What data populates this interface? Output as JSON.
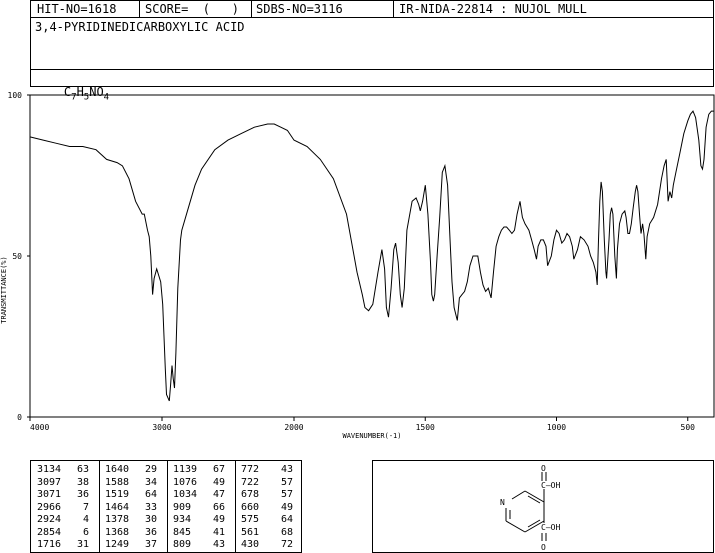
{
  "header": {
    "hit_no": "HIT-NO=1618",
    "score": "SCORE=  (   )",
    "sdbs_no": "SDBS-NO=3116",
    "ir_info": "IR-NIDA-22814 : NUJOL MULL"
  },
  "compound": {
    "name": "3,4-PYRIDINEDICARBOXYLIC ACID",
    "formula_parts": [
      "C",
      "7",
      "H",
      "5",
      "NO",
      "4"
    ]
  },
  "chart_data": {
    "type": "line",
    "xlabel": "WAVENUMBER(-1)",
    "ylabel": "TRANSMITTANCE(%)",
    "xlim": [
      4000,
      400
    ],
    "ylim": [
      0,
      100
    ],
    "x_ticks": [
      4000,
      3000,
      2000,
      1500,
      1000,
      500
    ],
    "y_ticks": [
      0,
      50,
      100
    ],
    "x_tick_labels": [
      "4000",
      "3000",
      "2000",
      "1500",
      "1000",
      "500"
    ],
    "y_tick_labels": [
      "0",
      "50",
      "100"
    ],
    "grid": false,
    "series": [
      {
        "points": [
          [
            4000,
            87
          ],
          [
            3900,
            86
          ],
          [
            3800,
            85
          ],
          [
            3700,
            84
          ],
          [
            3600,
            84
          ],
          [
            3500,
            83
          ],
          [
            3420,
            80
          ],
          [
            3340,
            79
          ],
          [
            3300,
            78
          ],
          [
            3250,
            74
          ],
          [
            3200,
            67
          ],
          [
            3150,
            63
          ],
          [
            3134,
            63
          ],
          [
            3110,
            58
          ],
          [
            3097,
            56
          ],
          [
            3085,
            50
          ],
          [
            3071,
            38
          ],
          [
            3060,
            43
          ],
          [
            3040,
            46
          ],
          [
            3010,
            42
          ],
          [
            2995,
            35
          ],
          [
            2985,
            25
          ],
          [
            2975,
            15
          ],
          [
            2966,
            7
          ],
          [
            2955,
            6
          ],
          [
            2945,
            5
          ],
          [
            2935,
            10
          ],
          [
            2924,
            16
          ],
          [
            2915,
            12
          ],
          [
            2905,
            9
          ],
          [
            2895,
            20
          ],
          [
            2880,
            40
          ],
          [
            2860,
            55
          ],
          [
            2850,
            58
          ],
          [
            2800,
            65
          ],
          [
            2750,
            72
          ],
          [
            2700,
            77
          ],
          [
            2600,
            83
          ],
          [
            2500,
            86
          ],
          [
            2400,
            88
          ],
          [
            2300,
            90
          ],
          [
            2200,
            91
          ],
          [
            2150,
            91
          ],
          [
            2100,
            90
          ],
          [
            2050,
            89
          ],
          [
            2000,
            86
          ],
          [
            1950,
            84
          ],
          [
            1900,
            80
          ],
          [
            1850,
            74
          ],
          [
            1800,
            63
          ],
          [
            1760,
            45
          ],
          [
            1740,
            38
          ],
          [
            1730,
            34
          ],
          [
            1716,
            33
          ],
          [
            1700,
            35
          ],
          [
            1680,
            45
          ],
          [
            1665,
            52
          ],
          [
            1655,
            46
          ],
          [
            1648,
            34
          ],
          [
            1640,
            31
          ],
          [
            1630,
            40
          ],
          [
            1620,
            52
          ],
          [
            1613,
            54
          ],
          [
            1603,
            48
          ],
          [
            1595,
            38
          ],
          [
            1588,
            34
          ],
          [
            1580,
            40
          ],
          [
            1570,
            58
          ],
          [
            1550,
            67
          ],
          [
            1535,
            68
          ],
          [
            1525,
            66
          ],
          [
            1519,
            64
          ],
          [
            1510,
            67
          ],
          [
            1500,
            72
          ],
          [
            1490,
            63
          ],
          [
            1480,
            48
          ],
          [
            1475,
            38
          ],
          [
            1469,
            36
          ],
          [
            1464,
            38
          ],
          [
            1455,
            50
          ],
          [
            1445,
            62
          ],
          [
            1435,
            76
          ],
          [
            1425,
            78
          ],
          [
            1415,
            72
          ],
          [
            1405,
            54
          ],
          [
            1398,
            42
          ],
          [
            1390,
            34
          ],
          [
            1384,
            32
          ],
          [
            1378,
            30
          ],
          [
            1370,
            37
          ],
          [
            1360,
            38
          ],
          [
            1350,
            39
          ],
          [
            1340,
            42
          ],
          [
            1330,
            47
          ],
          [
            1318,
            50
          ],
          [
            1310,
            50
          ],
          [
            1300,
            50
          ],
          [
            1290,
            45
          ],
          [
            1280,
            41
          ],
          [
            1270,
            39
          ],
          [
            1260,
            40
          ],
          [
            1249,
            37
          ],
          [
            1240,
            45
          ],
          [
            1230,
            53
          ],
          [
            1220,
            56
          ],
          [
            1210,
            58
          ],
          [
            1200,
            59
          ],
          [
            1190,
            59
          ],
          [
            1180,
            58
          ],
          [
            1170,
            57
          ],
          [
            1160,
            58
          ],
          [
            1150,
            63
          ],
          [
            1139,
            67
          ],
          [
            1130,
            62
          ],
          [
            1120,
            60
          ],
          [
            1105,
            58
          ],
          [
            1095,
            55
          ],
          [
            1085,
            52
          ],
          [
            1076,
            49
          ],
          [
            1070,
            53
          ],
          [
            1060,
            55
          ],
          [
            1050,
            55
          ],
          [
            1040,
            53
          ],
          [
            1034,
            47
          ],
          [
            1020,
            50
          ],
          [
            1010,
            55
          ],
          [
            1000,
            58
          ],
          [
            990,
            57
          ],
          [
            980,
            54
          ],
          [
            970,
            55
          ],
          [
            960,
            57
          ],
          [
            950,
            56
          ],
          [
            940,
            53
          ],
          [
            934,
            49
          ],
          [
            920,
            52
          ],
          [
            909,
            56
          ],
          [
            895,
            55
          ],
          [
            880,
            53
          ],
          [
            870,
            50
          ],
          [
            860,
            48
          ],
          [
            850,
            45
          ],
          [
            845,
            41
          ],
          [
            840,
            55
          ],
          [
            835,
            67
          ],
          [
            830,
            73
          ],
          [
            825,
            70
          ],
          [
            818,
            55
          ],
          [
            812,
            45
          ],
          [
            809,
            43
          ],
          [
            800,
            55
          ],
          [
            795,
            63
          ],
          [
            790,
            65
          ],
          [
            785,
            63
          ],
          [
            778,
            50
          ],
          [
            772,
            43
          ],
          [
            768,
            52
          ],
          [
            760,
            60
          ],
          [
            750,
            63
          ],
          [
            740,
            64
          ],
          [
            735,
            62
          ],
          [
            728,
            57
          ],
          [
            722,
            57
          ],
          [
            715,
            60
          ],
          [
            708,
            65
          ],
          [
            700,
            70
          ],
          [
            695,
            72
          ],
          [
            690,
            70
          ],
          [
            684,
            63
          ],
          [
            678,
            57
          ],
          [
            672,
            60
          ],
          [
            667,
            57
          ],
          [
            660,
            49
          ],
          [
            655,
            56
          ],
          [
            645,
            60
          ],
          [
            630,
            62
          ],
          [
            615,
            66
          ],
          [
            600,
            74
          ],
          [
            590,
            78
          ],
          [
            582,
            80
          ],
          [
            575,
            67
          ],
          [
            568,
            70
          ],
          [
            561,
            68
          ],
          [
            555,
            72
          ],
          [
            545,
            76
          ],
          [
            530,
            82
          ],
          [
            515,
            88
          ],
          [
            500,
            92
          ],
          [
            490,
            94
          ],
          [
            480,
            95
          ],
          [
            470,
            93
          ],
          [
            458,
            86
          ],
          [
            450,
            78
          ],
          [
            444,
            77
          ],
          [
            438,
            80
          ],
          [
            430,
            90
          ],
          [
            420,
            94
          ],
          [
            410,
            95
          ],
          [
            400,
            95
          ]
        ]
      }
    ]
  },
  "peak_table": [
    [
      [
        "3134",
        "63"
      ],
      [
        "3097",
        "38"
      ],
      [
        "3071",
        "36"
      ],
      [
        "2966",
        "7"
      ],
      [
        "2924",
        "4"
      ],
      [
        "2854",
        "6"
      ],
      [
        "1716",
        "31"
      ]
    ],
    [
      [
        "1640",
        "29"
      ],
      [
        "1588",
        "34"
      ],
      [
        "1519",
        "64"
      ],
      [
        "1464",
        "33"
      ],
      [
        "1378",
        "30"
      ],
      [
        "1368",
        "36"
      ],
      [
        "1249",
        "37"
      ]
    ],
    [
      [
        "1139",
        "67"
      ],
      [
        "1076",
        "49"
      ],
      [
        "1034",
        "47"
      ],
      [
        "909",
        "66"
      ],
      [
        "934",
        "49"
      ],
      [
        "845",
        "41"
      ],
      [
        "809",
        "43"
      ]
    ],
    [
      [
        "772",
        "43"
      ],
      [
        "722",
        "57"
      ],
      [
        "678",
        "57"
      ],
      [
        "660",
        "49"
      ],
      [
        "575",
        "64"
      ],
      [
        "561",
        "68"
      ],
      [
        "430",
        "72"
      ]
    ]
  ],
  "structure_labels": {
    "o_top": "O",
    "oh_top": "C—OH",
    "n_atom": "N",
    "oh_bottom": "C—OH",
    "o_bottom": "O"
  }
}
